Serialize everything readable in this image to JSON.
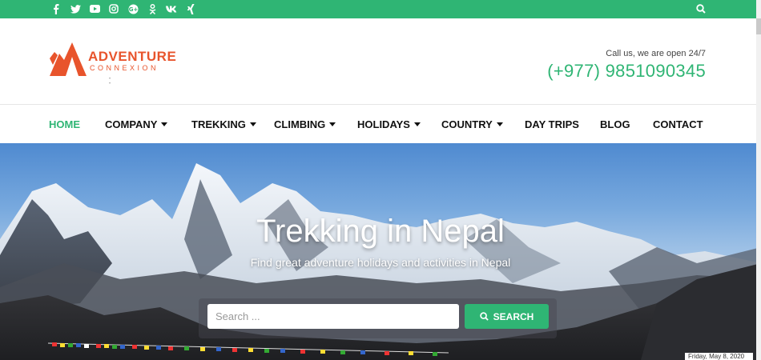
{
  "topbar": {
    "social_icons": [
      {
        "name": "facebook-icon",
        "glyph": "f"
      },
      {
        "name": "twitter-icon",
        "glyph": "t"
      },
      {
        "name": "youtube-icon",
        "glyph": "▶"
      },
      {
        "name": "instagram-icon",
        "glyph": "◎"
      },
      {
        "name": "googleplus-icon",
        "glyph": "G"
      },
      {
        "name": "odnoklassniki-icon",
        "glyph": "ok"
      },
      {
        "name": "vk-icon",
        "glyph": "vk"
      },
      {
        "name": "xing-icon",
        "glyph": "x"
      }
    ],
    "accent": "#2fb574"
  },
  "header": {
    "logo_word": "ADVENTURE",
    "logo_sub": "CONNEXION",
    "call_us": "Call us, we are open 24/7",
    "phone": "(+977) 9851090345",
    "brand_color": "#e8542c"
  },
  "nav": {
    "items": [
      {
        "label": "HOME",
        "active": true,
        "dropdown": false
      },
      {
        "label": "COMPANY",
        "active": false,
        "dropdown": true
      },
      {
        "label": "TREKKING",
        "active": false,
        "dropdown": true
      },
      {
        "label": "CLIMBING",
        "active": false,
        "dropdown": true
      },
      {
        "label": "HOLIDAYS",
        "active": false,
        "dropdown": true
      },
      {
        "label": "COUNTRY",
        "active": false,
        "dropdown": true
      },
      {
        "label": "DAY TRIPS",
        "active": false,
        "dropdown": false
      },
      {
        "label": "BLOG",
        "active": false,
        "dropdown": false
      },
      {
        "label": "CONTACT",
        "active": false,
        "dropdown": false
      }
    ]
  },
  "hero": {
    "title": "Trekking in Nepal",
    "subtitle": "Find great adventure holidays and activities in Nepal",
    "search_placeholder": "Search ...",
    "search_button": "SEARCH",
    "date": "Friday, May 8, 2020"
  }
}
